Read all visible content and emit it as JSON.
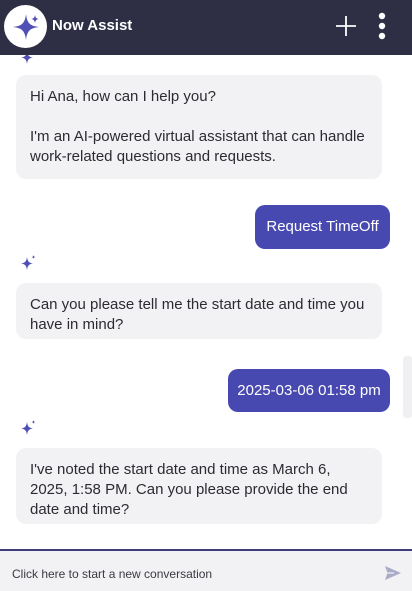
{
  "header": {
    "title": "Now Assist",
    "logo_icon": "sparkle-icon",
    "new_chat_icon": "plus-icon",
    "menu_icon": "kebab-menu-icon",
    "background": "#2e2f45"
  },
  "messages": [
    {
      "role": "assistant",
      "lines": [
        "Hi Ana, how can I help you?",
        "",
        "I'm an AI-powered virtual assistant that can handle",
        "work-related questions and requests."
      ]
    },
    {
      "role": "user",
      "text": "Request TimeOff"
    },
    {
      "role": "assistant",
      "lines": [
        "Can you please tell me the start date and time you",
        "have in mind?"
      ]
    },
    {
      "role": "user",
      "text": "2025-03-06 01:58 pm"
    },
    {
      "role": "assistant",
      "lines": [
        "I've noted the start date and time as March 6,",
        "2025, 1:58 PM. Can you please provide the end",
        "date and time?"
      ]
    }
  ],
  "footer": {
    "placeholder": "Click here to start a new conversation",
    "send_icon": "send-icon"
  },
  "colors": {
    "accent": "#4849b0",
    "bot_bubble": "#f2f2f4",
    "sparkle": "#4f4fb5"
  }
}
